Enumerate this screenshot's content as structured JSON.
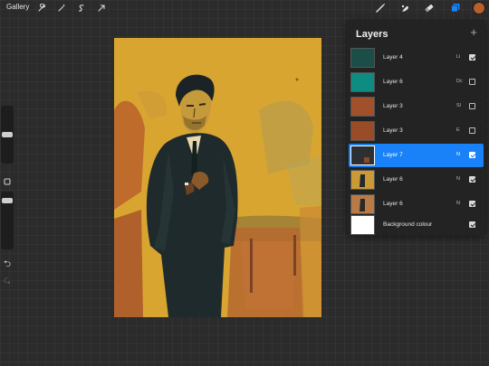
{
  "topbar": {
    "gallery_label": "Gallery",
    "left_tools": [
      "wrench-icon",
      "magic-wand-icon",
      "selection-icon",
      "transform-arrow-icon"
    ],
    "right_tools": [
      "brush-icon",
      "smudge-icon",
      "eraser-icon",
      "layers-icon"
    ],
    "active_color": "#b8602c",
    "layers_active_color": "#1a82f8"
  },
  "sidebar": {
    "brush_size_level": 0.5,
    "opacity_level": 0.5,
    "icons": [
      "modifier-square-icon",
      "undo-icon",
      "redo-icon"
    ]
  },
  "layers_panel": {
    "title": "Layers",
    "add_icon": "plus-icon",
    "layers": [
      {
        "name": "Layer 4",
        "blend": "Li",
        "visible": true,
        "selected": false,
        "thumb": "#1b4e47"
      },
      {
        "name": "Layer 6",
        "blend": "Dc",
        "visible": false,
        "selected": false,
        "thumb": "#0f8c82"
      },
      {
        "name": "Layer 3",
        "blend": "Sl",
        "visible": false,
        "selected": false,
        "thumb": "#a0502a"
      },
      {
        "name": "Layer 3",
        "blend": "E",
        "visible": false,
        "selected": false,
        "thumb": "#9a4c28"
      },
      {
        "name": "Layer 7",
        "blend": "N",
        "visible": true,
        "selected": true,
        "thumb": "#2d2f30"
      },
      {
        "name": "Layer 6",
        "blend": "N",
        "visible": true,
        "selected": false,
        "thumb": "#c99a36"
      },
      {
        "name": "Layer 6",
        "blend": "N",
        "visible": true,
        "selected": false,
        "thumb": "#b87b45"
      },
      {
        "name": "Background colour",
        "blend": "",
        "visible": true,
        "selected": false,
        "thumb": "#ffffff"
      }
    ]
  },
  "canvas": {
    "background": "#d8a430",
    "accent_orange": "#b8602c",
    "figure_dark": "#1f2a2c"
  }
}
